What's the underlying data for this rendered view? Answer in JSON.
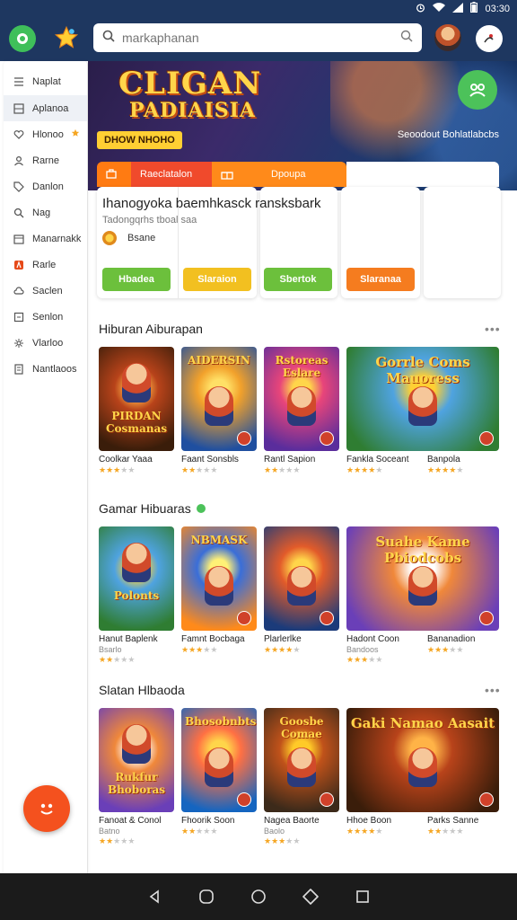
{
  "status_bar": {
    "time": "03:30"
  },
  "search": {
    "placeholder": "markaphanan"
  },
  "sidebar": {
    "items": [
      {
        "label": "Naplat",
        "icon": "list-icon"
      },
      {
        "label": "Aplanoa",
        "icon": "grid-icon",
        "active": true
      },
      {
        "label": "Hlonoo",
        "icon": "heart-icon",
        "star": true
      },
      {
        "label": "Rarne",
        "icon": "person-icon"
      },
      {
        "label": "Danlon",
        "icon": "tag-icon"
      },
      {
        "label": "Nag",
        "icon": "search-icon"
      },
      {
        "label": "Manarnakk",
        "icon": "calendar-icon"
      },
      {
        "label": "Rarle",
        "icon": "fire-icon"
      },
      {
        "label": "Saclen",
        "icon": "cloud-icon"
      },
      {
        "label": "Senlon",
        "icon": "box-icon"
      },
      {
        "label": "Vlarloo",
        "icon": "gear-icon"
      },
      {
        "label": "Nantlaoos",
        "icon": "doc-icon"
      }
    ]
  },
  "hero": {
    "title_line1": "CLIGAN",
    "title_line2": "PADIAISIA",
    "cta": "DHOW NHOHO",
    "caption": "Seoodout Bohlatlabcbs"
  },
  "promo": {
    "tabs": [
      "Raeclatalon",
      "Dpoupa"
    ],
    "title": "Ihanogyoka baemhkasck ransksbark",
    "subtitle": "Tadongqrhs tboal saa",
    "coin_label": "Bsane",
    "buttons": [
      {
        "label": "Hbadea",
        "color": "#6cc03c"
      },
      {
        "label": "Slaraion",
        "color": "#f2c020"
      },
      {
        "label": "Sbertok",
        "color": "#6cc03c"
      },
      {
        "label": "Slaranaa",
        "color": "#f57c1f"
      }
    ]
  },
  "sections": [
    {
      "title": "Hiburan Aiburapan",
      "verified": false,
      "more": "•••",
      "games": [
        {
          "name": "Coolkar Yaaa",
          "sub": "",
          "rating": 3,
          "art": "PIRDAN Cosmanas"
        },
        {
          "name": "Faant Sonsbls",
          "sub": "",
          "rating": 2.5,
          "art": "AIDERSIN"
        },
        {
          "name": "Rantl Sapion",
          "sub": "",
          "rating": 2.5,
          "art": "Rstoreas Eslare"
        },
        {
          "name": "Fankla Soceant",
          "sub": "",
          "rating": 4,
          "art": "Gorrle Coms Mauoress"
        },
        {
          "name": "Banpola",
          "sub": "",
          "rating": 4,
          "art": ""
        }
      ]
    },
    {
      "title": "Gamar Hibuaras",
      "verified": true,
      "more": "",
      "games": [
        {
          "name": "Hanut Baplenk",
          "sub": "Bsarlo",
          "rating": 2,
          "art": "Polonts"
        },
        {
          "name": "Famnt Bocbaga",
          "sub": "",
          "rating": 3,
          "art": "NBMASK"
        },
        {
          "name": "Plarlerlke",
          "sub": "",
          "rating": 4,
          "art": ""
        },
        {
          "name": "Hadont Coon",
          "sub": "Bandoos",
          "rating": 3.5,
          "art": "Suahe Kame Pbiodcobs"
        },
        {
          "name": "Bananadion",
          "sub": "",
          "rating": 3.5,
          "art": ""
        }
      ]
    },
    {
      "title": "Slatan Hlbaoda",
      "verified": false,
      "more": "•••",
      "games": [
        {
          "name": "Fanoat & Conol",
          "sub": "Batno",
          "rating": 2.5,
          "art": "Rukfur Bhoboras"
        },
        {
          "name": "Fhoorik Soon",
          "sub": "",
          "rating": 2,
          "art": "Bhosobnbts"
        },
        {
          "name": "Nagea Baorte",
          "sub": "Baolo",
          "rating": 3.5,
          "art": "Goosbe Comae"
        },
        {
          "name": "Hhoe Boon",
          "sub": "",
          "rating": 4,
          "art": "Gaki Namao Aasait"
        },
        {
          "name": "Parks Sanne",
          "sub": "",
          "rating": 2,
          "art": ""
        }
      ]
    }
  ],
  "colors": {
    "app_bar": "#1e3760",
    "accent_green": "#4cc25a",
    "accent_orange": "#ff7b12",
    "fab": "#f4511e"
  }
}
